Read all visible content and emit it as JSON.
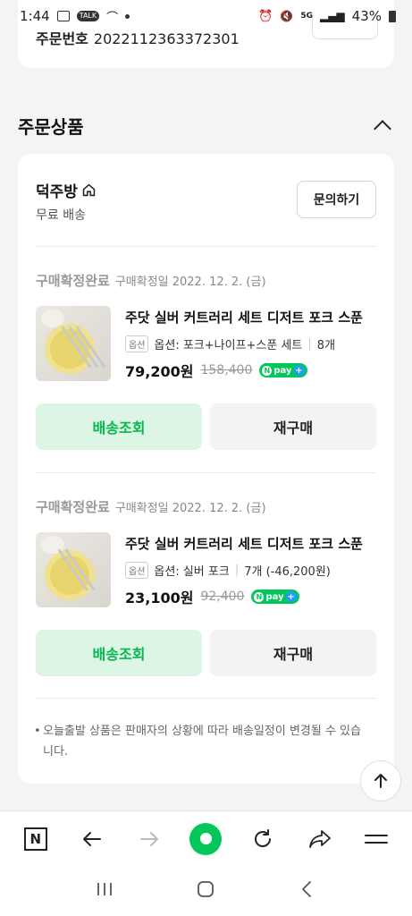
{
  "status_bar": {
    "time": "1:44",
    "talk_badge": "TALK",
    "network": "5G",
    "battery": "43%"
  },
  "order": {
    "label": "주문번호",
    "number": "2022112363372301"
  },
  "section": {
    "title": "주문상품"
  },
  "seller": {
    "name": "덕주방",
    "shipping": "무료 배송",
    "inquiry_label": "문의하기"
  },
  "items": [
    {
      "status": "구매확정완료",
      "confirm_date": "구매확정일 2022. 12. 2. (금)",
      "name": "주닷 실버 커트러리 세트 디저트 포크 스푼",
      "option_badge": "옵션",
      "option": "옵션: 포크+나이프+스푼 세트",
      "qty": "8개",
      "price": "79,200원",
      "price_old": "158,400",
      "track_label": "배송조회",
      "rebuy_label": "재구매"
    },
    {
      "status": "구매확정완료",
      "confirm_date": "구매확정일 2022. 12. 2. (금)",
      "name": "주닷 실버 커트러리 세트 디저트 포크 스푼",
      "option_badge": "옵션",
      "option": "옵션: 실버 포크",
      "qty": "7개 (-46,200원)",
      "price": "23,100원",
      "price_old": "92,400",
      "track_label": "배송조회",
      "rebuy_label": "재구매"
    }
  ],
  "npay": {
    "label": "pay"
  },
  "notice": "오늘출발 상품은 판매자의 상황에 따라 배송일정이 변경될 수 있습니다.",
  "colors": {
    "accent": "#03c75a",
    "track_bg": "#dcf5e5",
    "page_bg": "#f4f4f6"
  }
}
